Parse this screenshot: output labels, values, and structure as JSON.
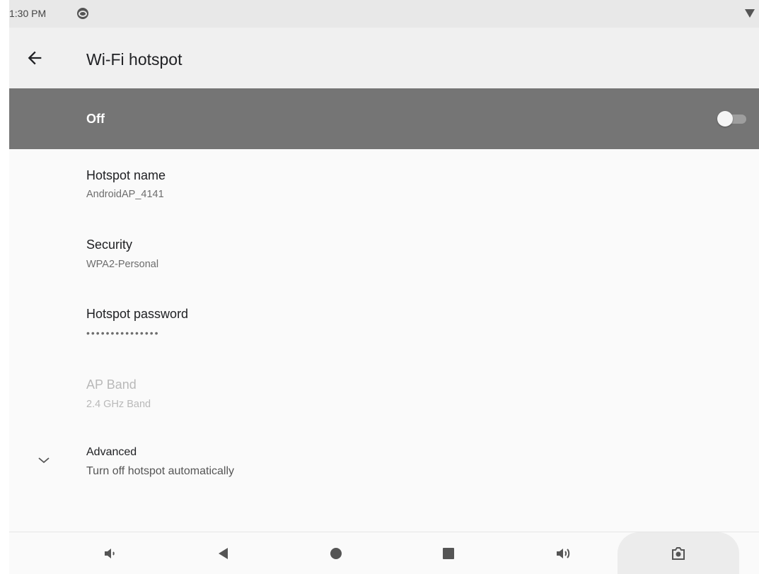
{
  "status_bar": {
    "time": "1:30 PM",
    "icons": [
      "android-notification-icon",
      "wifi-signal-icon"
    ]
  },
  "app_bar": {
    "title": "Wi-Fi hotspot",
    "back_icon": "back-arrow-icon"
  },
  "master_switch": {
    "label": "Off",
    "enabled": false
  },
  "preferences": [
    {
      "title": "Hotspot name",
      "summary": "AndroidAP_4141",
      "enabled": true
    },
    {
      "title": "Security",
      "summary": "WPA2-Personal",
      "enabled": true
    },
    {
      "title": "Hotspot password",
      "summary": "•••••••••••••••",
      "enabled": true
    },
    {
      "title": "AP Band",
      "summary": "2.4 GHz Band",
      "enabled": false
    }
  ],
  "advanced": {
    "title": "Advanced",
    "summary": "Turn off hotspot automatically",
    "icon": "chevron-down-icon"
  },
  "nav_bar": {
    "buttons": [
      "volume-down-icon",
      "back-triangle-icon",
      "home-circle-icon",
      "recents-square-icon",
      "volume-up-icon",
      "screenshot-camera-icon"
    ]
  },
  "colors": {
    "switch_bar": "#757575",
    "app_bar": "#f0f0f0",
    "background": "#fafafa"
  }
}
